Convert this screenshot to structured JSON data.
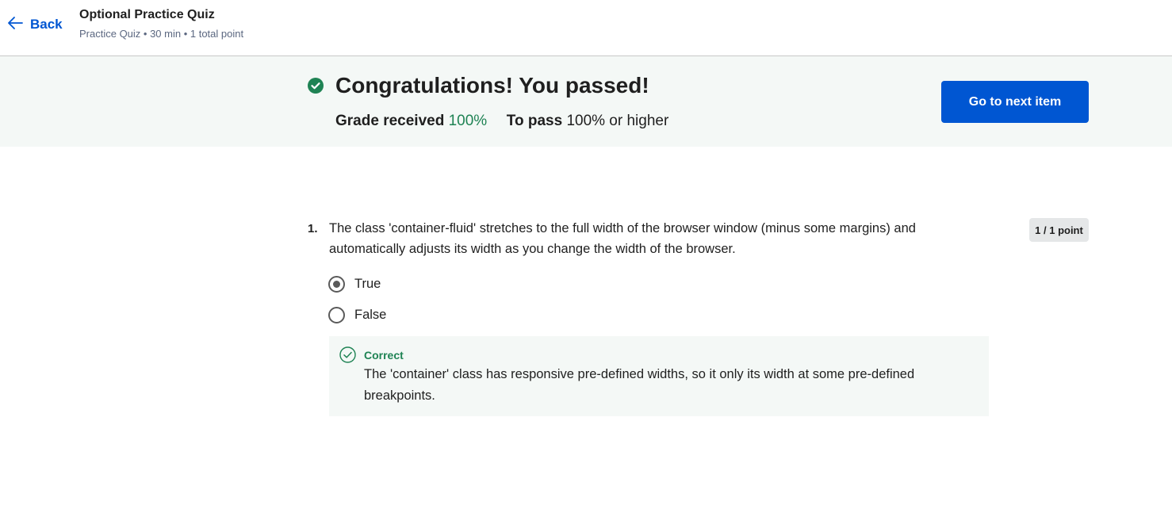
{
  "header": {
    "back_label": "Back",
    "title": "Optional Practice Quiz",
    "meta": "Practice Quiz • 30 min • 1 total point"
  },
  "banner": {
    "heading": "Congratulations! You passed!",
    "grade_label": "Grade received",
    "grade_value": "100%",
    "pass_label": "To pass",
    "pass_value": "100% or higher",
    "next_button": "Go to next item",
    "colors": {
      "success": "#1f8354",
      "primary": "#0056d2"
    }
  },
  "question": {
    "number": "1.",
    "text": "The class 'container-fluid' stretches to the full width of the browser window (minus some margins) and automatically adjusts its width as you change the width of the browser.",
    "points": "1 / 1 point",
    "options": [
      {
        "label": "True",
        "selected": true
      },
      {
        "label": "False",
        "selected": false
      }
    ],
    "feedback": {
      "label": "Correct",
      "text": "The 'container' class has responsive pre-defined widths, so it only its width at some pre-defined breakpoints."
    }
  }
}
